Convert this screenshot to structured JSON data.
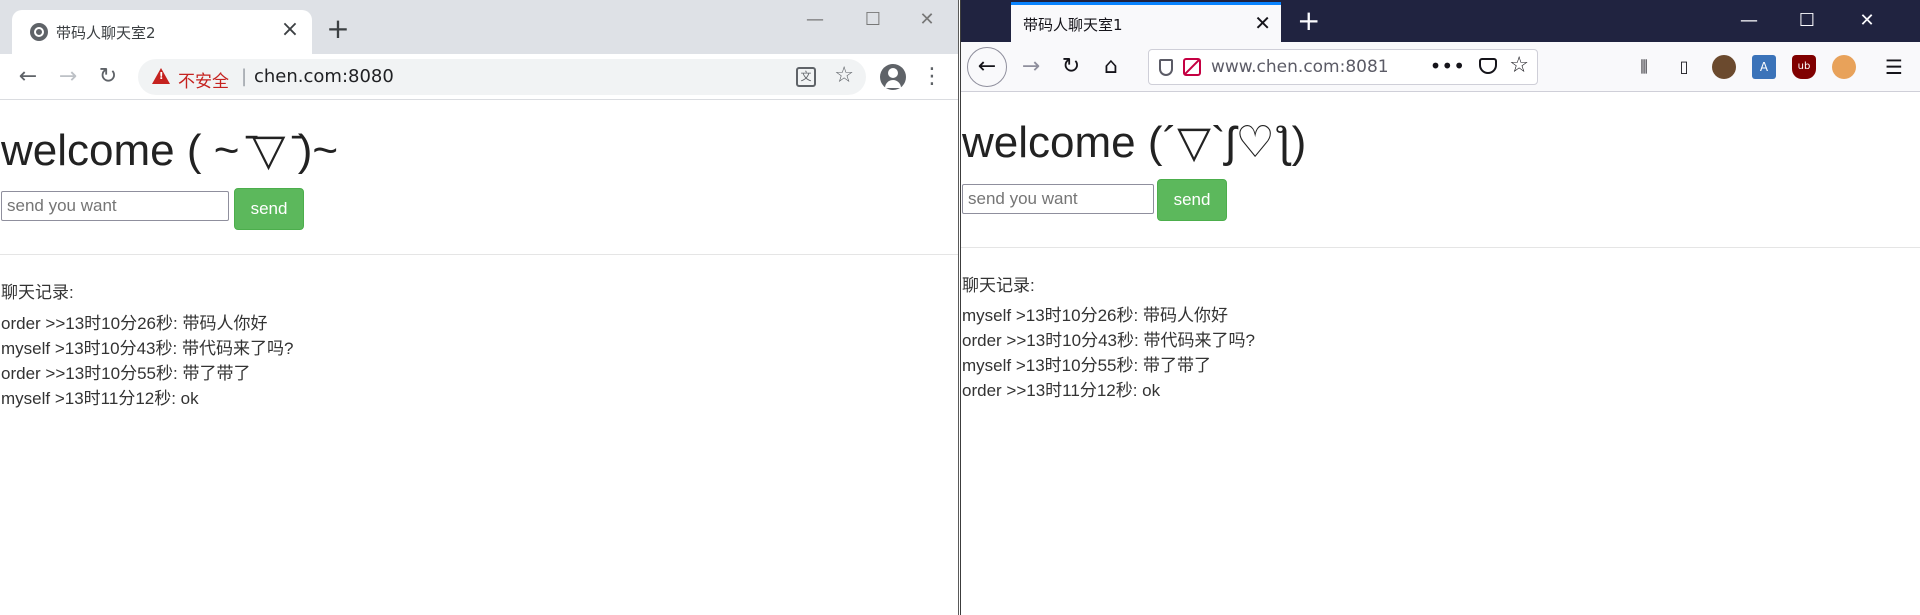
{
  "chrome": {
    "tab_title": "带码人聊天室2",
    "insecure_label": "不安全",
    "url": "chen.com:8080",
    "page": {
      "welcome": "welcome ( ~ ̄▽ ̄)~",
      "input_placeholder": "send you want",
      "send_label": "send",
      "history_label": "聊天记录:",
      "messages": [
        "order >>13时10分26秒:  带码人你好",
        "myself >13时10分43秒:  带代码来了吗?",
        "order >>13时10分55秒:  带了带了",
        "myself >13时11分12秒:  ok"
      ]
    }
  },
  "firefox": {
    "tab_title": "带码人聊天室1",
    "url": "www.chen.com:8081",
    "page": {
      "welcome": "welcome (´▽`ʃ♡ƪ)",
      "input_placeholder": "send you want",
      "send_label": "send",
      "history_label": "聊天记录:",
      "messages": [
        "myself >13时10分26秒:  带码人你好",
        "order >>13时10分43秒:  带代码来了吗?",
        "myself >13时10分55秒:  带了带了",
        "order >>13时11分12秒:  ok"
      ]
    }
  },
  "colors": {
    "send_button": "#5cb85c",
    "insecure_red": "#c5221f",
    "firefox_tabbar": "#202340",
    "chrome_tabbar": "#dee1e6"
  },
  "icons": {
    "chrome_translate": "文"
  }
}
